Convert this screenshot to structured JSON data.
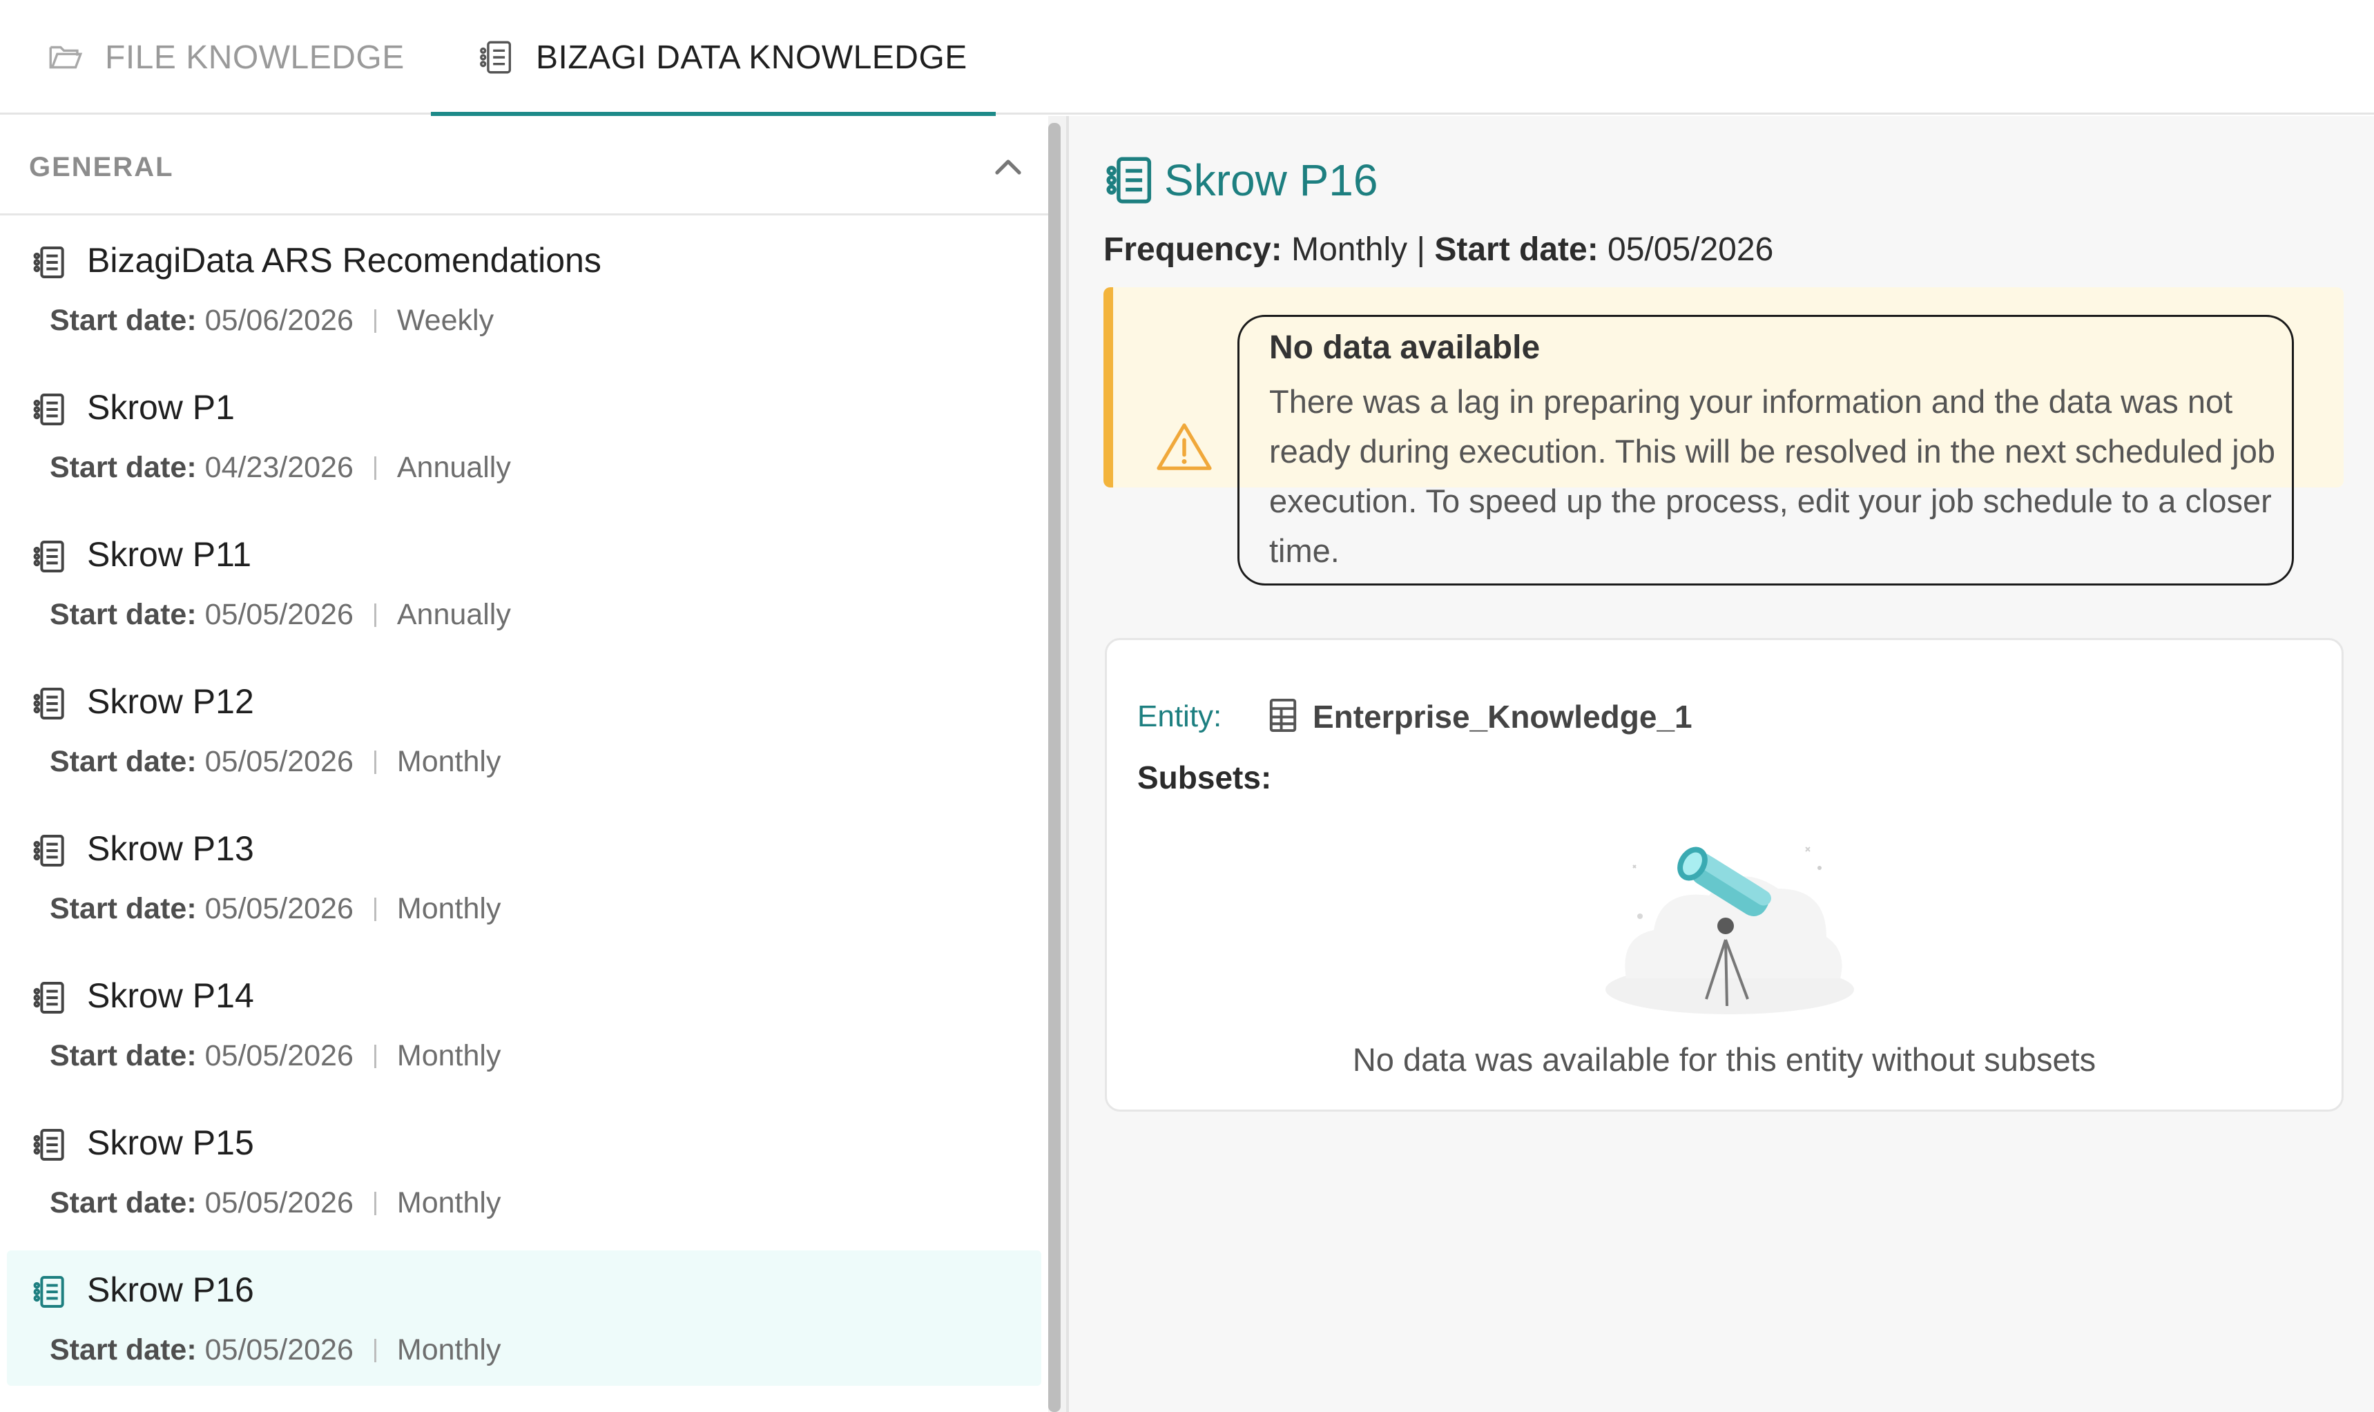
{
  "tabs": [
    {
      "label": "FILE KNOWLEDGE",
      "active": false
    },
    {
      "label": "BIZAGI DATA KNOWLEDGE",
      "active": true
    }
  ],
  "sidebar": {
    "section_title": "GENERAL",
    "start_label": "Start date:",
    "items": [
      {
        "title": "BizagiData ARS Recomendations",
        "start": "05/06/2026",
        "frequency": "Weekly"
      },
      {
        "title": "Skrow P1",
        "start": "04/23/2026",
        "frequency": "Annually"
      },
      {
        "title": "Skrow P11",
        "start": "05/05/2026",
        "frequency": "Annually"
      },
      {
        "title": "Skrow P12",
        "start": "05/05/2026",
        "frequency": "Monthly"
      },
      {
        "title": "Skrow P13",
        "start": "05/05/2026",
        "frequency": "Monthly"
      },
      {
        "title": "Skrow P14",
        "start": "05/05/2026",
        "frequency": "Monthly"
      },
      {
        "title": "Skrow P15",
        "start": "05/05/2026",
        "frequency": "Monthly"
      },
      {
        "title": "Skrow P16",
        "start": "05/05/2026",
        "frequency": "Monthly",
        "selected": true
      }
    ]
  },
  "detail": {
    "title": "Skrow P16",
    "frequency_label": "Frequency:",
    "frequency": "Monthly",
    "separator": "|",
    "start_label": "Start date:",
    "start": "05/05/2026",
    "alert": {
      "title": "No data available",
      "body": "There was a lag in preparing your information and the data was not ready during execution. This will be resolved in the next scheduled job execution. To speed up the process, edit your job schedule to a closer time."
    },
    "entity_label": "Entity:",
    "entity_value": "Enterprise_Knowledge_1",
    "subsets_label": "Subsets:",
    "empty_message": "No data was available for this entity without subsets"
  },
  "colors": {
    "accent": "#1d8a89",
    "alert_bar": "#f3b43c",
    "alert_bg": "#fef8e4",
    "selected_bg": "#eefbfa"
  }
}
